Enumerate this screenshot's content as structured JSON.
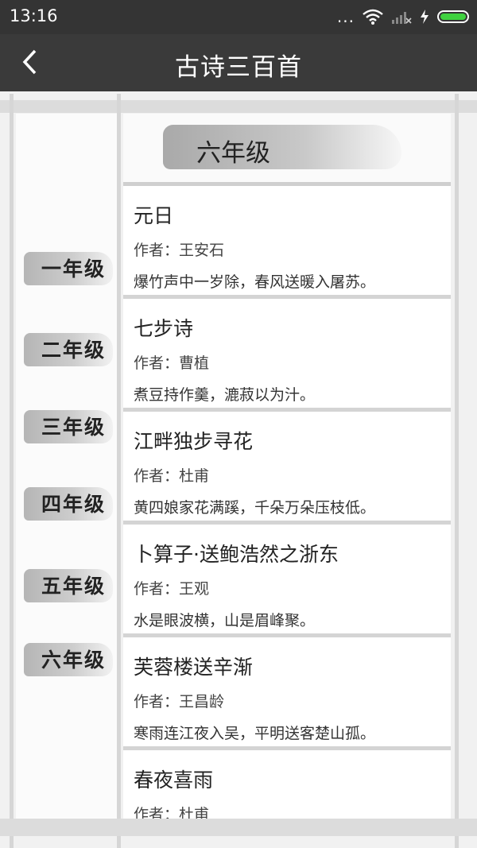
{
  "status": {
    "time": "13:16",
    "dots": "..."
  },
  "app": {
    "title": "古诗三百首"
  },
  "grades": [
    "一年级",
    "二年级",
    "三年级",
    "四年级",
    "五年级",
    "六年级"
  ],
  "current_grade": "六年级",
  "poems": [
    {
      "title": "元日",
      "author": "作者：王安石",
      "line": "爆竹声中一岁除，春风送暖入屠苏。"
    },
    {
      "title": "七步诗",
      "author": "作者：曹植",
      "line": "煮豆持作羹，漉菽以为汁。"
    },
    {
      "title": "江畔独步寻花",
      "author": "作者：杜甫",
      "line": "黄四娘家花满蹊，千朵万朵压枝低。"
    },
    {
      "title": "卜算子·送鲍浩然之浙东",
      "author": "作者：王观",
      "line": "水是眼波横，山是眉峰聚。"
    },
    {
      "title": "芙蓉楼送辛渐",
      "author": "作者：王昌龄",
      "line": "寒雨连江夜入吴，平明送客楚山孤。"
    },
    {
      "title": "春夜喜雨",
      "author": "作者：杜甫",
      "line": ""
    }
  ]
}
